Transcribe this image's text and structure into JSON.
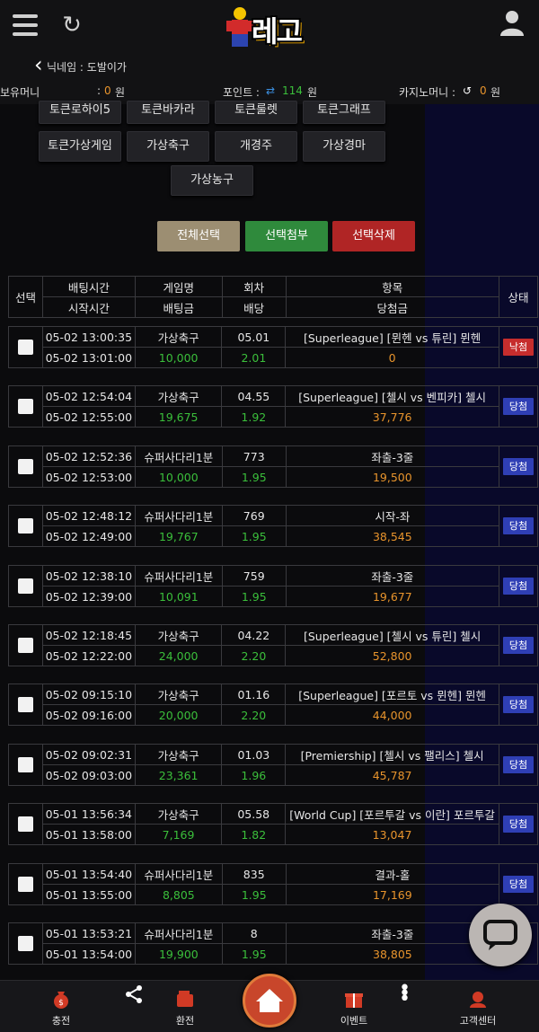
{
  "header": {
    "logo_text": "레고"
  },
  "nick": {
    "label": "닉네임 : 도발이가"
  },
  "money": {
    "hold_label": "보유머니",
    "hold_sep": ": ",
    "hold_value": "0",
    "hold_unit": "원",
    "point_label": "포인트 :",
    "point_value": "114",
    "point_unit": "원",
    "casino_label": "카지노머니 :",
    "casino_value": "0",
    "casino_unit": "원"
  },
  "games_partial": [
    "토큰로하이5",
    "토큰바카라",
    "토큰룰렛",
    "토큰그래프"
  ],
  "games": [
    "토큰가상게임",
    "가상축구",
    "개경주",
    "가상경마",
    "가상농구"
  ],
  "actions": {
    "select_all": "전체선택",
    "attach": "선택첨부",
    "delete": "선택삭제"
  },
  "table_header": {
    "select": "선택",
    "bet_time": "배팅시간",
    "start_time": "시작시간",
    "game_name": "게임명",
    "bet_amount": "배팅금",
    "round": "회차",
    "odds": "배당",
    "item": "항목",
    "win_amount": "당첨금",
    "status": "상태"
  },
  "bets": [
    {
      "bet_time": "05-02 13:00:35",
      "start_time": "05-02 13:01:00",
      "game": "가상축구",
      "amount": "10,000",
      "round": "05.01",
      "odds": "2.01",
      "item": "[Superleague] [뮌헨 vs 튜린] 뮌헨",
      "win": "0",
      "status": "낙첨",
      "status_type": "lose"
    },
    {
      "bet_time": "05-02 12:54:04",
      "start_time": "05-02 12:55:00",
      "game": "가상축구",
      "amount": "19,675",
      "round": "04.55",
      "odds": "1.92",
      "item": "[Superleague] [첼시 vs 벤피카] 첼시",
      "win": "37,776",
      "status": "당첨",
      "status_type": "win"
    },
    {
      "bet_time": "05-02 12:52:36",
      "start_time": "05-02 12:53:00",
      "game": "슈퍼사다리1분",
      "amount": "10,000",
      "round": "773",
      "odds": "1.95",
      "item": "좌출-3줄",
      "win": "19,500",
      "status": "당첨",
      "status_type": "win"
    },
    {
      "bet_time": "05-02 12:48:12",
      "start_time": "05-02 12:49:00",
      "game": "슈퍼사다리1분",
      "amount": "19,767",
      "round": "769",
      "odds": "1.95",
      "item": "시작-좌",
      "win": "38,545",
      "status": "당첨",
      "status_type": "win"
    },
    {
      "bet_time": "05-02 12:38:10",
      "start_time": "05-02 12:39:00",
      "game": "슈퍼사다리1분",
      "amount": "10,091",
      "round": "759",
      "odds": "1.95",
      "item": "좌출-3줄",
      "win": "19,677",
      "status": "당첨",
      "status_type": "win"
    },
    {
      "bet_time": "05-02 12:18:45",
      "start_time": "05-02 12:22:00",
      "game": "가상축구",
      "amount": "24,000",
      "round": "04.22",
      "odds": "2.20",
      "item": "[Superleague] [첼시 vs 튜린] 첼시",
      "win": "52,800",
      "status": "당첨",
      "status_type": "win"
    },
    {
      "bet_time": "05-02 09:15:10",
      "start_time": "05-02 09:16:00",
      "game": "가상축구",
      "amount": "20,000",
      "round": "01.16",
      "odds": "2.20",
      "item": "[Superleague] [포르토 vs 뮌헨] 뮌헨",
      "win": "44,000",
      "status": "당첨",
      "status_type": "win"
    },
    {
      "bet_time": "05-02 09:02:31",
      "start_time": "05-02 09:03:00",
      "game": "가상축구",
      "amount": "23,361",
      "round": "01.03",
      "odds": "1.96",
      "item": "[Premiership] [첼시 vs 팰리스] 첼시",
      "win": "45,787",
      "status": "당첨",
      "status_type": "win"
    },
    {
      "bet_time": "05-01 13:56:34",
      "start_time": "05-01 13:58:00",
      "game": "가상축구",
      "amount": "7,169",
      "round": "05.58",
      "odds": "1.82",
      "item": "[World Cup] [포르투갈 vs 이란] 포르투갈",
      "win": "13,047",
      "status": "당첨",
      "status_type": "win"
    },
    {
      "bet_time": "05-01 13:54:40",
      "start_time": "05-01 13:55:00",
      "game": "슈퍼사다리1분",
      "amount": "8,805",
      "round": "835",
      "odds": "1.95",
      "item": "결과-홀",
      "win": "17,169",
      "status": "당첨",
      "status_type": "win"
    },
    {
      "bet_time": "05-01 13:53:21",
      "start_time": "05-01 13:54:00",
      "game": "슈퍼사다리1분",
      "amount": "19,900",
      "round": "8",
      "odds": "1.95",
      "item": "좌출-3줄",
      "win": "38,805",
      "status": "",
      "status_type": "none"
    }
  ],
  "bottom_nav": {
    "charge": "충전",
    "exchange": "환전",
    "event": "이벤트",
    "support": "고객센터"
  }
}
